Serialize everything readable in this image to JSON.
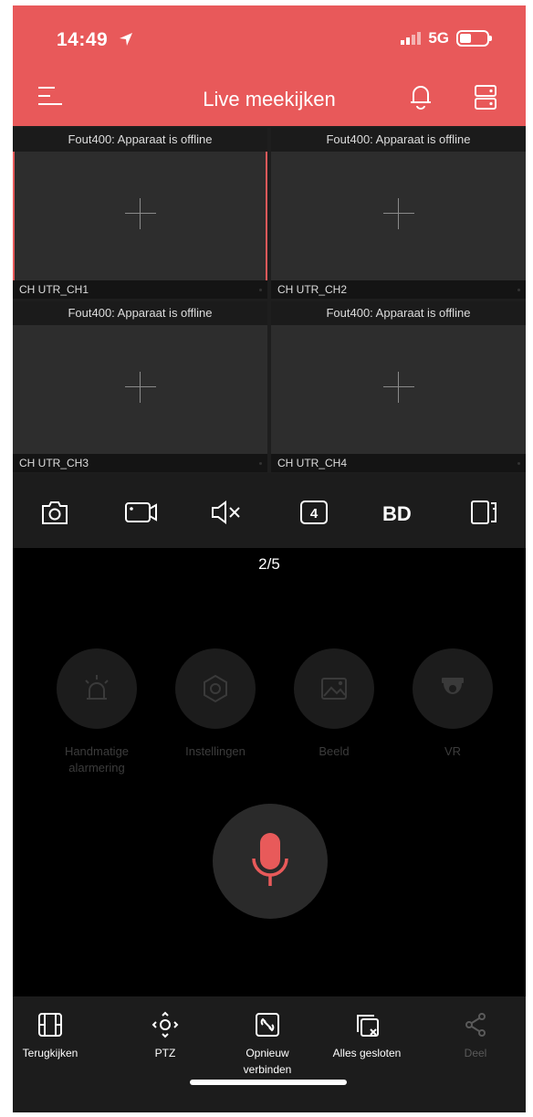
{
  "status_bar": {
    "time": "14:49",
    "network": "5G"
  },
  "header": {
    "title": "Live meekijken"
  },
  "tiles": [
    {
      "error": "Fout400: Apparaat is offline",
      "channel": "CH UTR_CH1"
    },
    {
      "error": "Fout400: Apparaat is offline",
      "channel": "CH UTR_CH2"
    },
    {
      "error": "Fout400: Apparaat is offline",
      "channel": "CH UTR_CH3"
    },
    {
      "error": "Fout400: Apparaat is offline",
      "channel": "CH UTR_CH4"
    }
  ],
  "toolbar": {
    "split_count": "4",
    "quality": "BD"
  },
  "page_indicator": "2/5",
  "features": [
    {
      "label": "Handmatige alarmering",
      "icon": "alarm-light-icon"
    },
    {
      "label": "Instellingen",
      "icon": "hex-nut-icon"
    },
    {
      "label": "Beeld",
      "icon": "image-icon"
    },
    {
      "label": "VR",
      "icon": "dome-camera-icon"
    }
  ],
  "bottom_bar": [
    {
      "label": "Terugkijken",
      "icon": "film-icon"
    },
    {
      "label": "PTZ",
      "icon": "ptz-icon"
    },
    {
      "label": "Opnieuw verbinden",
      "icon": "reconnect-icon"
    },
    {
      "label": "Alles gesloten",
      "icon": "close-all-icon"
    },
    {
      "label": "Deel",
      "icon": "share-icon"
    }
  ],
  "colors": {
    "accent": "#e8595a",
    "mic": "#e85a5a",
    "background": "#000000"
  }
}
